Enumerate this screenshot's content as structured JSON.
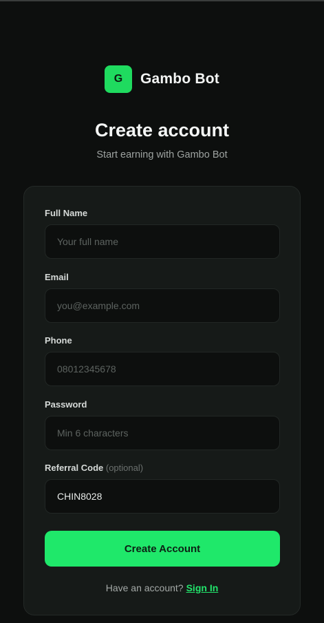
{
  "brand": {
    "logo_letter": "G",
    "name": "Gambo Bot"
  },
  "heading": "Create account",
  "subheading": "Start earning with Gambo Bot",
  "form": {
    "fields": [
      {
        "label": "Full Name",
        "placeholder": "Your full name",
        "value": ""
      },
      {
        "label": "Email",
        "placeholder": "you@example.com",
        "value": ""
      },
      {
        "label": "Phone",
        "placeholder": "08012345678",
        "value": ""
      },
      {
        "label": "Password",
        "placeholder": "Min 6 characters",
        "value": ""
      },
      {
        "label": "Referral Code",
        "label_suffix": "(optional)",
        "placeholder": "",
        "value": "CHIN8028"
      }
    ],
    "submit_label": "Create Account"
  },
  "footer": {
    "prompt": "Have an account?",
    "link_label": "Sign In"
  },
  "colors": {
    "background": "#0d0f0e",
    "card": "#161a18",
    "accent": "#1fe86a",
    "link": "#22e56c"
  }
}
